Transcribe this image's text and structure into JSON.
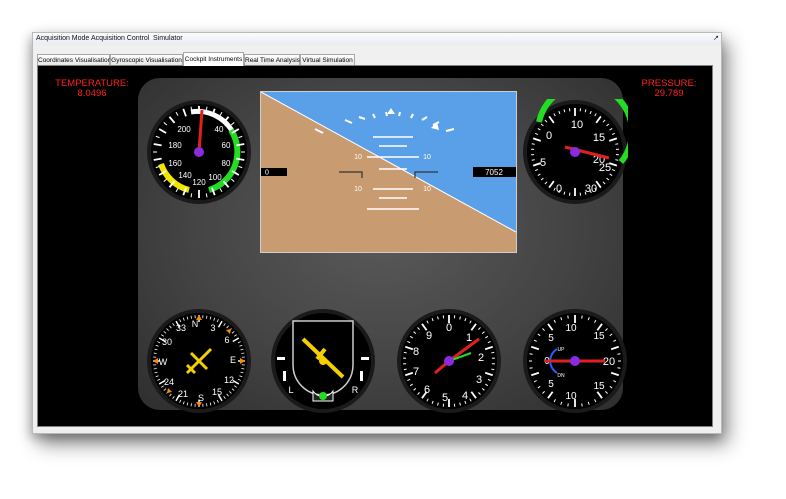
{
  "menubar": {
    "items": [
      "Acquisition Mode",
      "Acquisition Control",
      "Simulator"
    ],
    "pin_glyph": "↗"
  },
  "tabs": [
    {
      "label": "Coordinates Visualisation",
      "active": false
    },
    {
      "label": "Gyroscopic Visualisation",
      "active": false
    },
    {
      "label": "Cockpit Instruments",
      "active": true
    },
    {
      "label": "Real Time Analysis",
      "active": false
    },
    {
      "label": "Virtual Simulation",
      "active": false
    }
  ],
  "temperature": {
    "label": "TEMPERATURE:",
    "value": "8.0496"
  },
  "pressure": {
    "label": "PRESSURE:",
    "value": "29.789"
  },
  "airspeed": {
    "labels": [
      "40",
      "60",
      "80",
      "100",
      "120",
      "140",
      "160",
      "180",
      "200"
    ],
    "colors": {
      "white_arc": "#ffffff",
      "green_arc": "#22dd22",
      "yellow_arc": "#f2e600",
      "needle": "#e02020",
      "hub": "#8a2be2"
    }
  },
  "attitude": {
    "pitch_labels": [
      "10",
      "10",
      "10",
      "10"
    ],
    "left_box": "0",
    "right_box": "7052",
    "colors": {
      "sky": "#5aa0e8",
      "ground": "#c89b70"
    }
  },
  "altimeter": {
    "labels": [
      "0",
      "5",
      "10",
      "15",
      "20",
      "25",
      "30"
    ],
    "colors": {
      "arc": "#22dd22"
    }
  },
  "heading": {
    "labels": [
      "N",
      "3",
      "6",
      "E",
      "12",
      "15",
      "S",
      "21",
      "24",
      "W",
      "30",
      "33"
    ],
    "colors": {
      "aircraft": "#f5d000",
      "marks": "#ff8c00"
    }
  },
  "turn_coordinator": {
    "left_label": "L",
    "right_label": "R",
    "colors": {
      "aircraft": "#f5d000",
      "ball": "#22dd22"
    }
  },
  "clock": {
    "labels": [
      "0",
      "1",
      "2",
      "3",
      "4",
      "5",
      "6",
      "7",
      "8",
      "9"
    ]
  },
  "vsi": {
    "labels": [
      "0",
      "5",
      "10",
      "15",
      "20",
      "15",
      "10",
      "5"
    ],
    "up_label": "UP",
    "dn_label": "DN"
  }
}
